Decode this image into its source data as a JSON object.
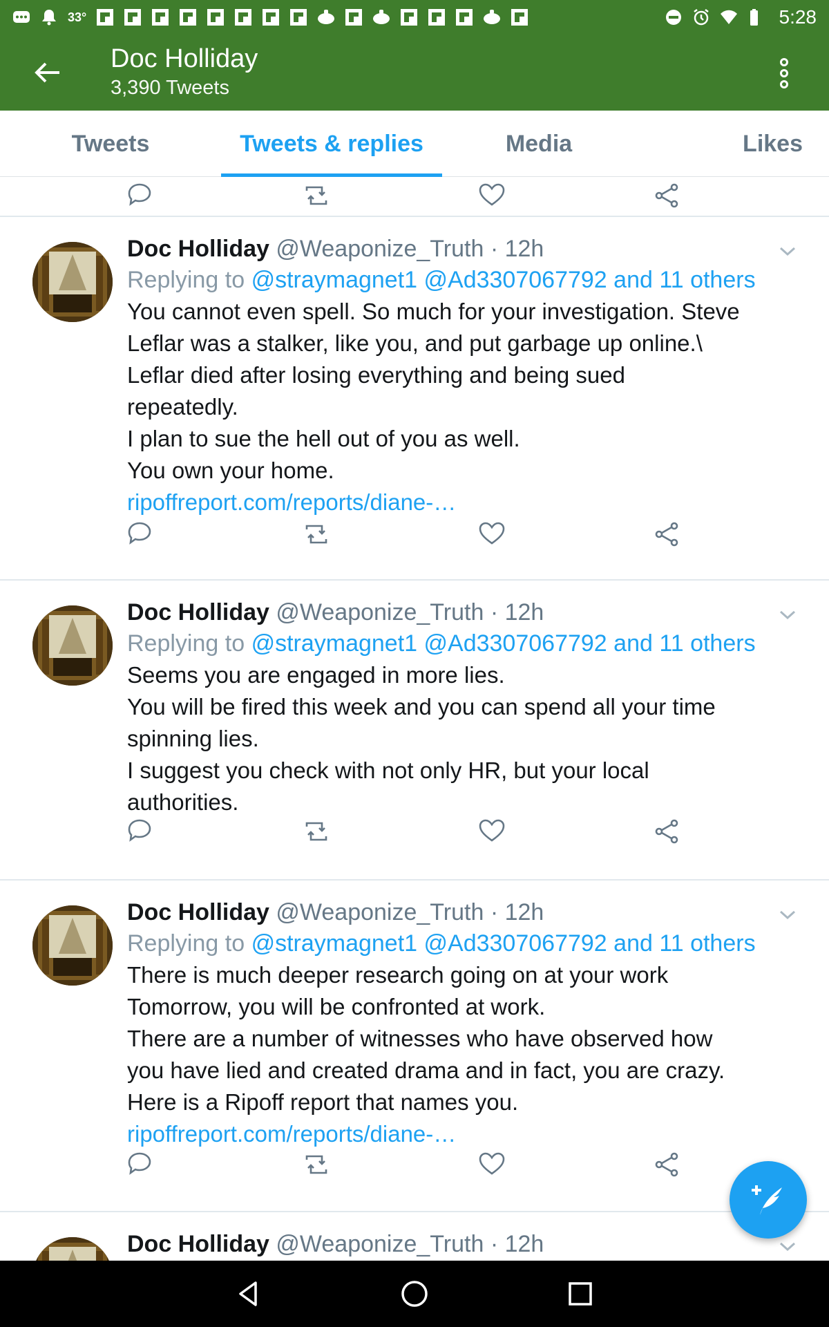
{
  "status_bar": {
    "temperature": "33°",
    "time": "5:28",
    "notification_icons": [
      "message-icon",
      "bell-icon",
      "flipboard-icon",
      "flipboard-icon",
      "flipboard-icon",
      "flipboard-icon",
      "flipboard-icon",
      "flipboard-icon",
      "flipboard-icon",
      "flipboard-icon",
      "cooking-icon",
      "flipboard-icon",
      "cooking-icon",
      "flipboard-icon",
      "flipboard-icon",
      "flipboard-icon",
      "cooking-icon",
      "flipboard-icon"
    ],
    "system_icons": [
      "dnd-icon",
      "alarm-icon",
      "wifi-icon",
      "battery-icon"
    ]
  },
  "app_bar": {
    "title": "Doc Holliday",
    "subtitle": "3,390 Tweets"
  },
  "tabs": [
    {
      "label": "Tweets",
      "active": false
    },
    {
      "label": "Tweets & replies",
      "active": true
    },
    {
      "label": "Media",
      "active": false
    },
    {
      "label": "Likes",
      "active": false
    }
  ],
  "tweets": [
    {
      "name": "Doc Holliday",
      "handle": "@Weaponize_Truth · 12h",
      "replying_prefix": "Replying to",
      "replying_to": "@straymagnet1 @Ad3307067792 and 11 others",
      "lines": [
        "You cannot even spell. So much for your investigation. Steve",
        "Leflar was a stalker, like you, and put garbage up online.\\",
        "Leflar died after losing everything and being sued",
        "repeatedly.",
        "I plan to sue the hell out of you as well.",
        "You own your home."
      ],
      "link": "ripoffreport.com/reports/diane-…"
    },
    {
      "name": "Doc Holliday",
      "handle": "@Weaponize_Truth · 12h",
      "replying_prefix": "Replying to",
      "replying_to": "@straymagnet1 @Ad3307067792 and 11 others",
      "lines": [
        "Seems you are engaged in more lies.",
        "You will be fired this week and you can spend all your time",
        "spinning lies.",
        "I suggest you check with not only HR, but your local",
        "authorities."
      ],
      "link": ""
    },
    {
      "name": "Doc Holliday",
      "handle": "@Weaponize_Truth · 12h",
      "replying_prefix": "Replying to",
      "replying_to": "@straymagnet1 @Ad3307067792 and 11 others",
      "lines": [
        "There is much deeper research going on at your work",
        "Tomorrow, you will be confronted at work.",
        "There are a number of witnesses who have observed how",
        "you have lied and created drama and in fact, you are crazy.",
        "Here is a Ripoff report that names you."
      ],
      "link": "ripoffreport.com/reports/diane-…"
    },
    {
      "name": "Doc Holliday",
      "handle": "@Weaponize_Truth · 12h"
    }
  ],
  "action_icons": [
    "reply-icon",
    "retweet-icon",
    "like-icon",
    "share-icon"
  ],
  "fab": {
    "icon": "compose-tweet-icon"
  },
  "nav_bar": {
    "icons": [
      "back-triangle-icon",
      "home-circle-icon",
      "recents-square-icon"
    ]
  },
  "colors": {
    "app_bar": "#3f7d2c",
    "accent": "#1da1f2",
    "secondary_text": "#657786",
    "divider": "#e1e8ed"
  }
}
